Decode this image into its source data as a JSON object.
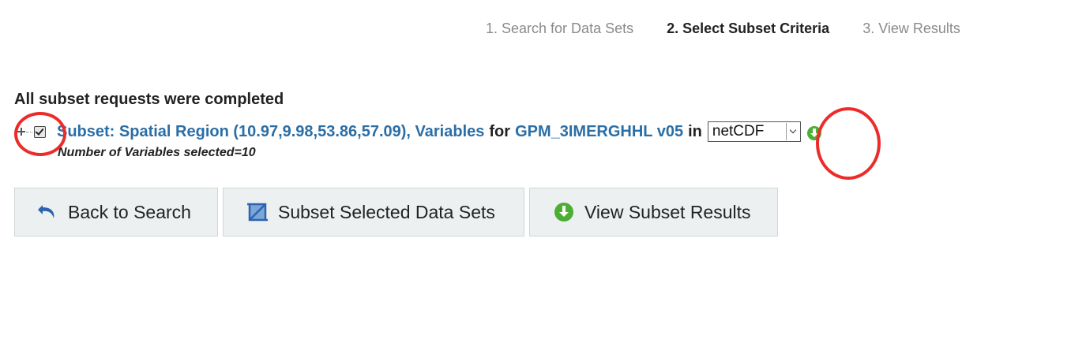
{
  "steps": [
    {
      "label": "1. Search for Data Sets",
      "active": false
    },
    {
      "label": "2. Select Subset Criteria",
      "active": true
    },
    {
      "label": "3. View Results",
      "active": false
    }
  ],
  "status": {
    "heading": "All subset requests were completed"
  },
  "subset": {
    "link_part1": "Subset: Spatial Region (10.97,9.98,53.86,57.09), Variables",
    "word_for": "for",
    "dataset_link": "GPM_3IMERGHHL v05",
    "word_in": "in",
    "format_selected": "netCDF",
    "variables_count_text": "Number of Variables selected=10",
    "checked": true
  },
  "actions": {
    "back_label": "Back to Search",
    "subset_label": "Subset Selected Data Sets",
    "view_label": "View Subset Results"
  },
  "icons": {
    "back": "undo-arrow-icon",
    "subset": "crop-icon",
    "view": "download-circle-icon",
    "format_download": "download-circle-icon"
  },
  "colors": {
    "link": "#2a6ea6",
    "active_step": "#222222",
    "inactive_step": "#8a8a8a",
    "download_green": "#4cae33",
    "annotation_red": "#ee2b2b",
    "button_bg": "#edf0f1"
  }
}
